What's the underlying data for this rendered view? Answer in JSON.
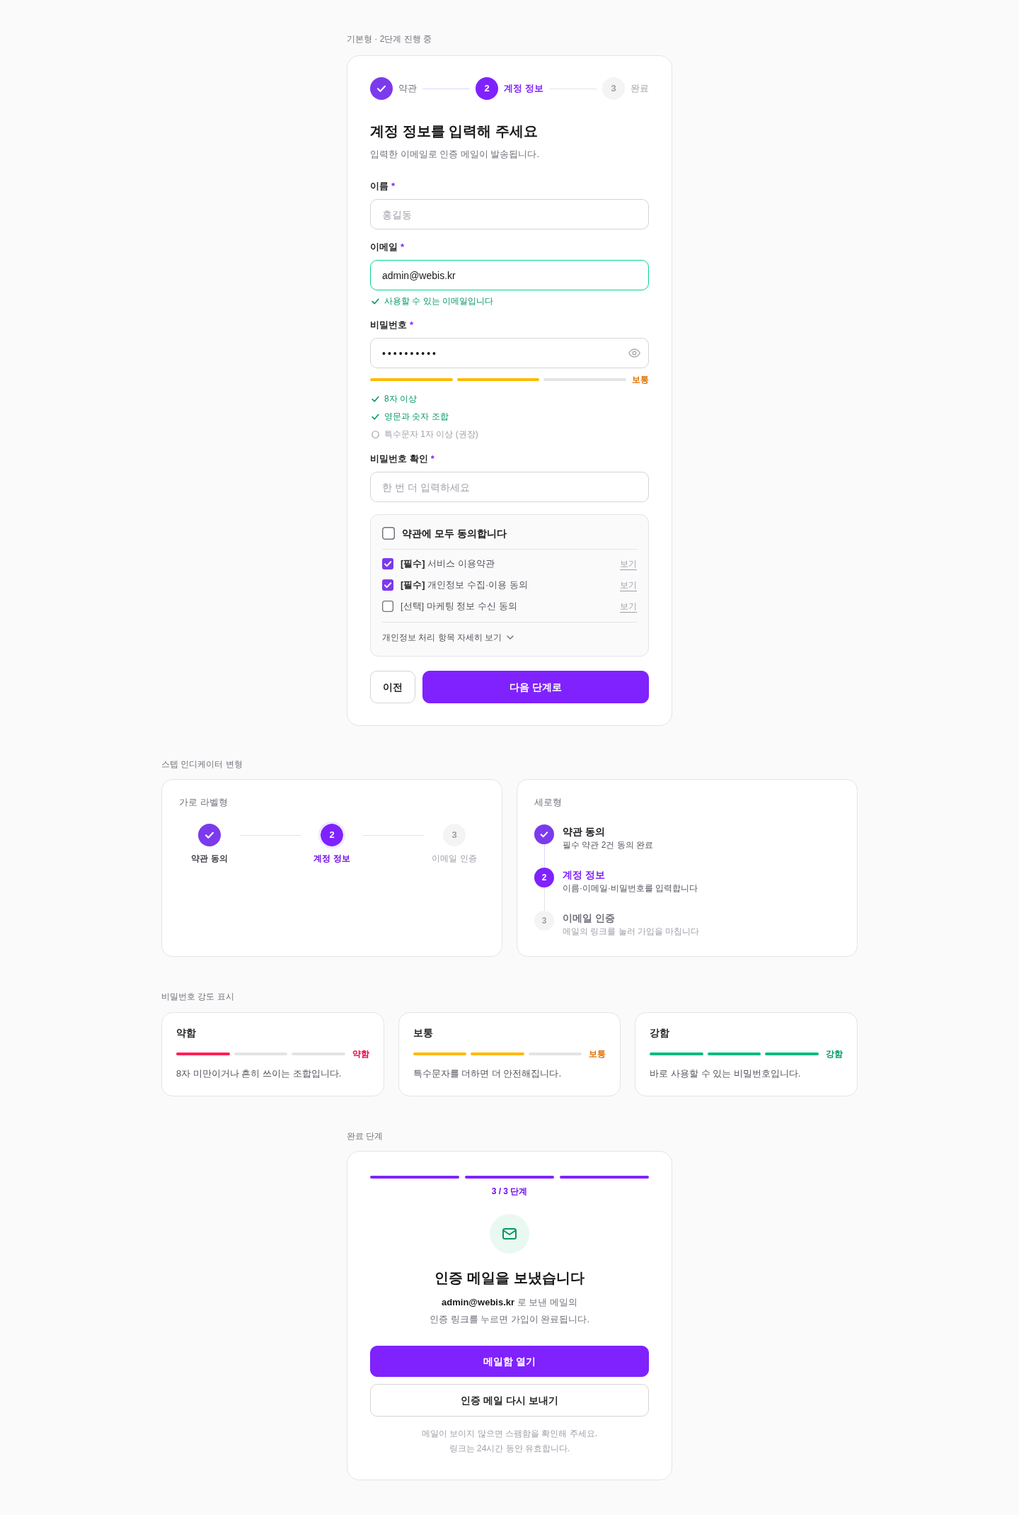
{
  "basic": {
    "caption": "기본형 · 2단계 진행 중",
    "steps": [
      {
        "done": true,
        "selected": false,
        "label": "약관"
      },
      {
        "done": false,
        "selected": true,
        "number": "2",
        "label": "계정 정보"
      },
      {
        "done": false,
        "selected": false,
        "number": "3",
        "label": "완료"
      }
    ],
    "title": "계정 정보를 입력해 주세요",
    "subtitle": "입력한 이메일로 인증 메일이 발송됩니다.",
    "fields": [
      {
        "kind": "text",
        "label": "이름",
        "required_mark": "*",
        "placeholder": "홍길동"
      },
      {
        "kind": "text",
        "label": "이메일",
        "required_mark": "*",
        "value": "admin@webis.kr",
        "valid": true,
        "message": "사용할 수 있는 이메일입니다"
      },
      {
        "kind": "password",
        "label": "비밀번호",
        "required_mark": "*",
        "value": "••••••••••",
        "strength": {
          "kind": "medium",
          "segments": [
            {
              "filled": true
            },
            {
              "filled": true
            },
            {
              "filled": false
            }
          ],
          "label": "보통"
        },
        "requirements": [
          {
            "met": true,
            "text": "8자 이상"
          },
          {
            "met": true,
            "text": "영문과 숫자 조합"
          },
          {
            "met": false,
            "text": "특수문자 1자 이상 (권장)"
          }
        ]
      },
      {
        "kind": "text",
        "label": "비밀번호 확인",
        "required_mark": "*",
        "placeholder": "한 번 더 입력하세요"
      }
    ],
    "agreements": {
      "all": {
        "label": "약관에 모두 동의합니다",
        "checked": false
      },
      "items": [
        {
          "text": "**[필수]** 서비스 이용약관",
          "checked": true,
          "link": "보기"
        },
        {
          "text": "**[필수]** 개인정보 수집·이용 동의",
          "checked": true,
          "link": "보기"
        },
        {
          "text": "[선택] 마케팅 정보 수신 동의",
          "checked": false,
          "link": "보기"
        }
      ],
      "details": "개인정보 처리 항목 자세히 보기"
    },
    "buttons": [
      {
        "kind": "secondary",
        "label": "이전"
      },
      {
        "kind": "primary",
        "label": "다음 단계로"
      }
    ]
  },
  "variants": {
    "caption": "스텝 인디케이터 변형",
    "horizontal": {
      "title": "가로 라벨형",
      "steps": [
        {
          "done": true,
          "selected": false,
          "label": "약관 동의"
        },
        {
          "done": false,
          "selected": true,
          "number": "2",
          "label": "계정 정보"
        },
        {
          "done": false,
          "selected": false,
          "number": "3",
          "label": "이메일 인증"
        }
      ]
    },
    "vertical": {
      "title": "세로형",
      "steps": [
        {
          "done": true,
          "selected": false,
          "title": "약관 동의",
          "description": "필수 약관 2건 동의 완료"
        },
        {
          "done": false,
          "selected": true,
          "number": "2",
          "title": "계정 정보",
          "description": "이름·이메일·비밀번호를 입력합니다"
        },
        {
          "done": false,
          "selected": false,
          "number": "3",
          "title": "이메일 인증",
          "description": "메일의 링크를 눌러 가입을 마칩니다"
        }
      ]
    }
  },
  "strength": {
    "caption": "비밀번호 강도 표시",
    "cards": [
      {
        "kind": "weak",
        "title": "약함",
        "segments": [
          {
            "filled": true
          },
          {
            "filled": false
          },
          {
            "filled": false
          }
        ],
        "label": "약함",
        "description": "8자 미만이거나 흔히 쓰이는 조합입니다."
      },
      {
        "kind": "medium",
        "title": "보통",
        "segments": [
          {
            "filled": true
          },
          {
            "filled": true
          },
          {
            "filled": false
          }
        ],
        "label": "보통",
        "description": "특수문자를 더하면 더 안전해집니다."
      },
      {
        "kind": "strong",
        "title": "강함",
        "segments": [
          {
            "filled": true
          },
          {
            "filled": true
          },
          {
            "filled": true
          }
        ],
        "label": "강함",
        "description": "바로 사용할 수 있는 비밀번호입니다."
      }
    ]
  },
  "complete": {
    "caption": "완료 단계",
    "progress": {
      "segments": [
        {
          "filled": true
        },
        {
          "filled": true
        },
        {
          "filled": true
        }
      ],
      "label": "3 / 3 단계"
    },
    "title": "인증 메일을 보냈습니다",
    "message": "**admin@webis.kr** 로 보낸 메일의\n인증 링크를 누르면 가입이 완료됩니다.",
    "buttons": [
      {
        "kind": "primary",
        "label": "메일함 열기"
      },
      {
        "kind": "secondary",
        "label": "인증 메일 다시 보내기"
      }
    ],
    "note": "메일이 보이지 않으면 스팸함을 확인해 주세요.\n링크는 24시간 동안 유효합니다."
  }
}
